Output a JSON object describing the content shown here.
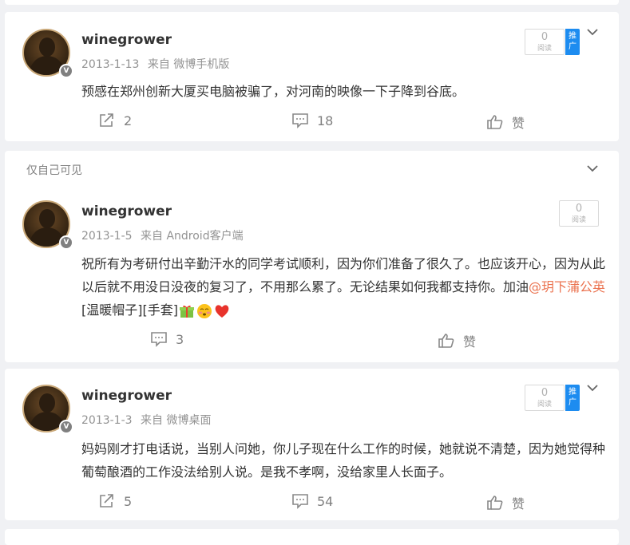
{
  "posts": [
    {
      "visibility": "",
      "username": "winegrower",
      "date": "2013-1-13",
      "source_prefix": "来自",
      "source": "微博手机版",
      "text": "预感在郑州创新大厦买电脑被骗了，对河南的映像一下子降到谷底。",
      "read_count": "0",
      "read_label": "阅读",
      "promo_label": "推广",
      "repost_count": "2",
      "comment_count": "18",
      "like_label": "赞"
    },
    {
      "visibility": "仅自己可见",
      "username": "winegrower",
      "date": "2013-1-5",
      "source_prefix": "来自",
      "source": "Android客户端",
      "text_before": "祝所有为考研付出辛勤汗水的同学考试顺利，因为你们准备了很久了。也应该开心，因为从此以后就不用没日没夜的复习了，不用那么累了。无论结果如何我都支持你。加油",
      "mention": "@玥下蒲公英",
      "text_after": " [温暖帽子][手套]",
      "read_count": "0",
      "read_label": "阅读",
      "comment_count": "3",
      "like_label": "赞"
    },
    {
      "visibility": "",
      "username": "winegrower",
      "date": "2013-1-3",
      "source_prefix": "来自",
      "source": "微博桌面",
      "text": "妈妈刚才打电话说，当别人问她，你儿子现在什么工作的时候，她就说不清楚，因为她觉得种葡萄酿酒的工作没法给别人说。是我不孝啊，没给家里人长面子。",
      "read_count": "0",
      "read_label": "阅读",
      "promo_label": "推广",
      "repost_count": "5",
      "comment_count": "54",
      "like_label": "赞"
    }
  ],
  "verified_mark": "V",
  "colors": {
    "mention": "#eb7350",
    "promo": "#1d8cf0",
    "meta": "#939393"
  }
}
